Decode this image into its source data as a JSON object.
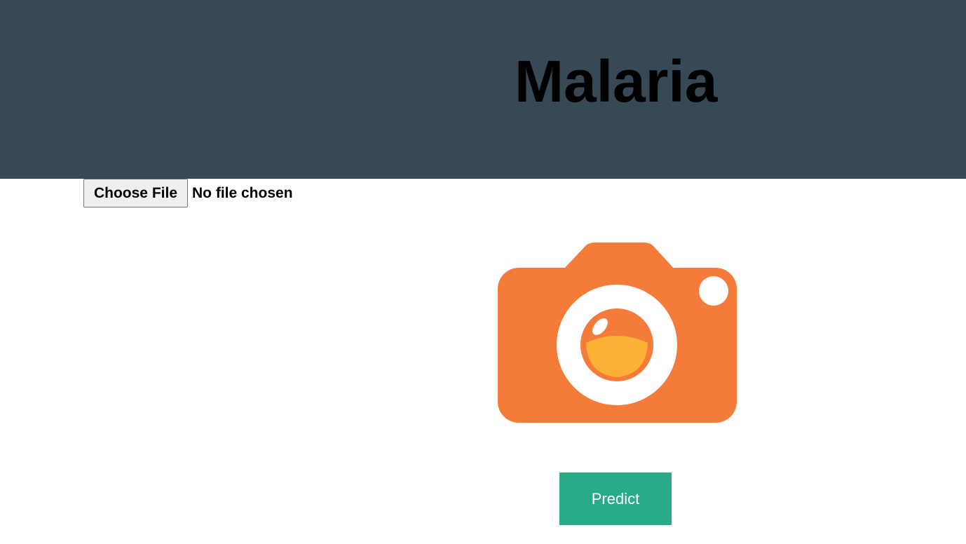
{
  "header": {
    "title": "Malaria",
    "background_color": "#374954"
  },
  "upload": {
    "choose_file_label": "Choose File",
    "status_text": "No file chosen"
  },
  "preview": {
    "icon": "camera-icon",
    "body_color": "#f47b3a",
    "lens_color": "#fdb036"
  },
  "actions": {
    "predict_label": "Predict",
    "predict_color": "#2aab88"
  }
}
